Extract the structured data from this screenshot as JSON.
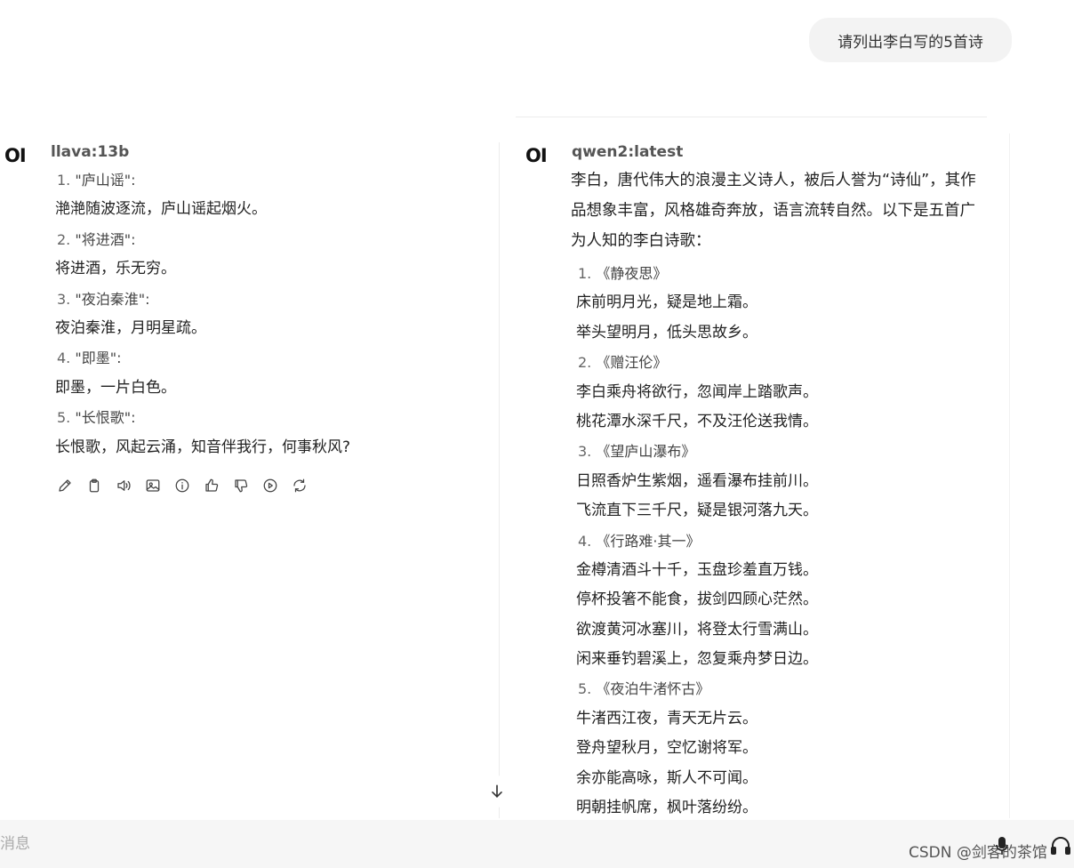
{
  "user_message": "请列出李白写的5首诗",
  "left_pane": {
    "logo": "OI",
    "model": "llava:13b",
    "items": [
      {
        "num": "1.",
        "title": "\"庐山谣\":",
        "lines": [
          "滟滟随波逐流，庐山谣起烟火。"
        ]
      },
      {
        "num": "2.",
        "title": "\"将进酒\":",
        "lines": [
          "将进酒，乐无穷。"
        ]
      },
      {
        "num": "3.",
        "title": "\"夜泊秦淮\":",
        "lines": [
          "夜泊秦淮，月明星疏。"
        ]
      },
      {
        "num": "4.",
        "title": "\"即墨\":",
        "lines": [
          "即墨，一片白色。"
        ]
      },
      {
        "num": "5.",
        "title": "\"长恨歌\":",
        "lines": [
          "长恨歌，风起云涌，知音伴我行，何事秋风?"
        ]
      }
    ],
    "actions": [
      "edit-icon",
      "copy-icon",
      "speaker-icon",
      "image-icon",
      "info-icon",
      "thumbs-up-icon",
      "thumbs-down-icon",
      "play-icon",
      "regenerate-icon"
    ]
  },
  "right_pane": {
    "logo": "OI",
    "model": "qwen2:latest",
    "intro": "李白，唐代伟大的浪漫主义诗人，被后人誉为“诗仙”，其作品想象丰富，风格雄奇奔放，语言流转自然。以下是五首广为人知的李白诗歌：",
    "items": [
      {
        "num": "1.",
        "title": "《静夜思》",
        "lines": [
          "床前明月光，疑是地上霜。",
          "举头望明月，低头思故乡。"
        ]
      },
      {
        "num": "2.",
        "title": "《赠汪伦》",
        "lines": [
          "李白乘舟将欲行，忽闻岸上踏歌声。",
          "桃花潭水深千尺，不及汪伦送我情。"
        ]
      },
      {
        "num": "3.",
        "title": "《望庐山瀑布》",
        "lines": [
          "日照香炉生紫烟，遥看瀑布挂前川。",
          "飞流直下三千尺，疑是银河落九天。"
        ]
      },
      {
        "num": "4.",
        "title": "《行路难·其一》",
        "lines": [
          "金樽清酒斗十千，玉盘珍羞直万钱。",
          "停杯投箸不能食，拔剑四顾心茫然。",
          "欲渡黄河冰塞川，将登太行雪满山。",
          "闲来垂钓碧溪上，忽复乘舟梦日边。"
        ]
      },
      {
        "num": "5.",
        "title": "《夜泊牛渚怀古》",
        "lines": [
          "牛渚西江夜，青天无片云。",
          "登舟望秋月，空忆谢将军。",
          "余亦能高咏，斯人不可闻。",
          "明朝挂帆席，枫叶落纷纷。"
        ]
      }
    ]
  },
  "composer": {
    "placeholder": "消息",
    "watermark": "CSDN @剑客的茶馆"
  }
}
